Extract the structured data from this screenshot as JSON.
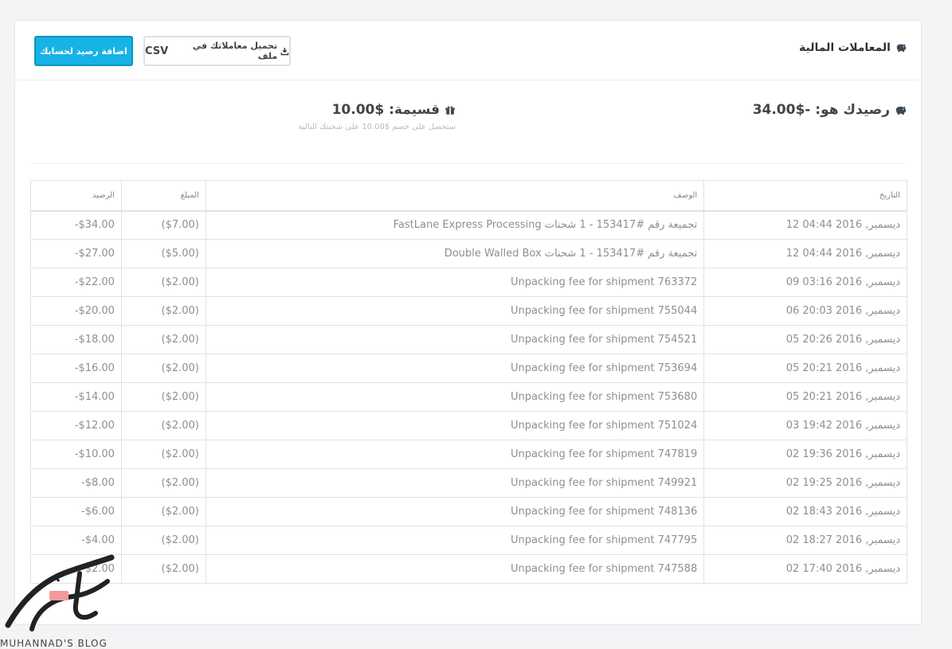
{
  "header": {
    "title": "المعاملات المالية",
    "add_balance_button": "اضافة رصيد لحسابك",
    "download_button": "تحميل معاملاتك في ملف",
    "download_format": "CSV"
  },
  "summary": {
    "balance_text": "رصيدك هو: -$34.00",
    "voucher_text": "قسيمة: $10.00",
    "voucher_note": "ستحصل على خصم $10.00 على شحنتك التالية"
  },
  "table": {
    "headers": {
      "date": "التاريخ",
      "description": "الوصف",
      "amount": "المبلغ",
      "balance": "الرصيد"
    },
    "rows": [
      {
        "date": "12 ديسمبر, 2016 04:44",
        "description": "FastLane Express Processing تجميعة رقم #153417 - 1 شحنات",
        "amount": "($7.00)",
        "balance": "-$34.00"
      },
      {
        "date": "12 ديسمبر, 2016 04:44",
        "description": "Double Walled Box تجميعة رقم #153417 - 1 شحنات",
        "amount": "($5.00)",
        "balance": "-$27.00"
      },
      {
        "date": "09 ديسمبر, 2016 03:16",
        "description": "Unpacking fee for shipment 763372",
        "amount": "($2.00)",
        "balance": "-$22.00"
      },
      {
        "date": "06 ديسمبر, 2016 20:03",
        "description": "Unpacking fee for shipment 755044",
        "amount": "($2.00)",
        "balance": "-$20.00"
      },
      {
        "date": "05 ديسمبر, 2016 20:26",
        "description": "Unpacking fee for shipment 754521",
        "amount": "($2.00)",
        "balance": "-$18.00"
      },
      {
        "date": "05 ديسمبر, 2016 20:21",
        "description": "Unpacking fee for shipment 753694",
        "amount": "($2.00)",
        "balance": "-$16.00"
      },
      {
        "date": "05 ديسمبر, 2016 20:21",
        "description": "Unpacking fee for shipment 753680",
        "amount": "($2.00)",
        "balance": "-$14.00"
      },
      {
        "date": "03 ديسمبر, 2016 19:42",
        "description": "Unpacking fee for shipment 751024",
        "amount": "($2.00)",
        "balance": "-$12.00"
      },
      {
        "date": "02 ديسمبر, 2016 19:36",
        "description": "Unpacking fee for shipment 747819",
        "amount": "($2.00)",
        "balance": "-$10.00"
      },
      {
        "date": "02 ديسمبر, 2016 19:25",
        "description": "Unpacking fee for shipment 749921",
        "amount": "($2.00)",
        "balance": "-$8.00"
      },
      {
        "date": "02 ديسمبر, 2016 18:43",
        "description": "Unpacking fee for shipment 748136",
        "amount": "($2.00)",
        "balance": "-$6.00"
      },
      {
        "date": "02 ديسمبر, 2016 18:27",
        "description": "Unpacking fee for shipment 747795",
        "amount": "($2.00)",
        "balance": "-$4.00"
      },
      {
        "date": "02 ديسمبر, 2016 17:40",
        "description": "Unpacking fee for shipment 747588",
        "amount": "($2.00)",
        "balance": "-$2.00"
      }
    ]
  },
  "watermark": {
    "text": "MUHANNAD'S BLOG"
  },
  "colors": {
    "primary": "#17b3e6",
    "primary_border": "#0e94c3",
    "text_muted": "#8a9097",
    "border": "#dfe2e6"
  },
  "icons": {
    "title": "piggy-bank-icon",
    "balance": "piggy-bank-icon",
    "voucher": "gift-icon",
    "download": "download-icon"
  }
}
